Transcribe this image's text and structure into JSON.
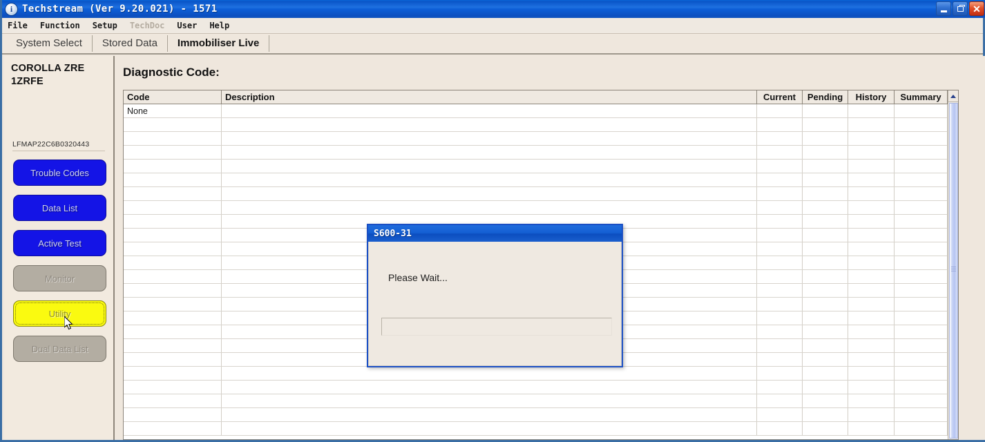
{
  "window": {
    "title": "Techstream (Ver 9.20.021) - 1571",
    "icon": "techstream-logo-icon",
    "minimize_label": "Minimize",
    "maximize_label": "Restore",
    "close_label": "Close"
  },
  "menubar": {
    "items": [
      {
        "label": "File",
        "disabled": false
      },
      {
        "label": "Function",
        "disabled": false
      },
      {
        "label": "Setup",
        "disabled": false
      },
      {
        "label": "TechDoc",
        "disabled": true
      },
      {
        "label": "User",
        "disabled": false
      },
      {
        "label": "Help",
        "disabled": false
      }
    ]
  },
  "tabs": [
    {
      "label": "System Select",
      "active": false
    },
    {
      "label": "Stored Data",
      "active": false
    },
    {
      "label": "Immobiliser Live",
      "active": true
    }
  ],
  "sidebar": {
    "vehicle_line1": "COROLLA ZRE",
    "vehicle_line2": "1ZRFE",
    "vin": "LFMAP22C6B0320443",
    "buttons": [
      {
        "label": "Trouble Codes",
        "state": "enabled"
      },
      {
        "label": "Data List",
        "state": "enabled"
      },
      {
        "label": "Active Test",
        "state": "enabled"
      },
      {
        "label": "Monitor",
        "state": "disabled"
      },
      {
        "label": "Utility",
        "state": "focused"
      },
      {
        "label": "Dual Data List",
        "state": "disabled"
      }
    ]
  },
  "main": {
    "page_title": "Diagnostic Code:",
    "table": {
      "columns": [
        "Code",
        "Description",
        "Current",
        "Pending",
        "History",
        "Summary"
      ],
      "rows": [
        [
          "None",
          "",
          "",
          "",
          "",
          ""
        ]
      ],
      "empty_row_count": 23
    },
    "scrollbar": {
      "up_arrow": "scroll-up-arrow-icon",
      "position": "top"
    }
  },
  "dialog": {
    "title": "S600-31",
    "message": "Please Wait...",
    "progress_value": 0
  },
  "colors": {
    "titlebar_blue": "#0D5ED6",
    "button_blue": "#1414E6",
    "button_yellow": "#FAFA10",
    "button_gray": "#B3ADA2",
    "panel_beige": "#EFE7DD",
    "header_beige": "#EFE9E1",
    "scroll_thumb": "#B6C5F2"
  }
}
